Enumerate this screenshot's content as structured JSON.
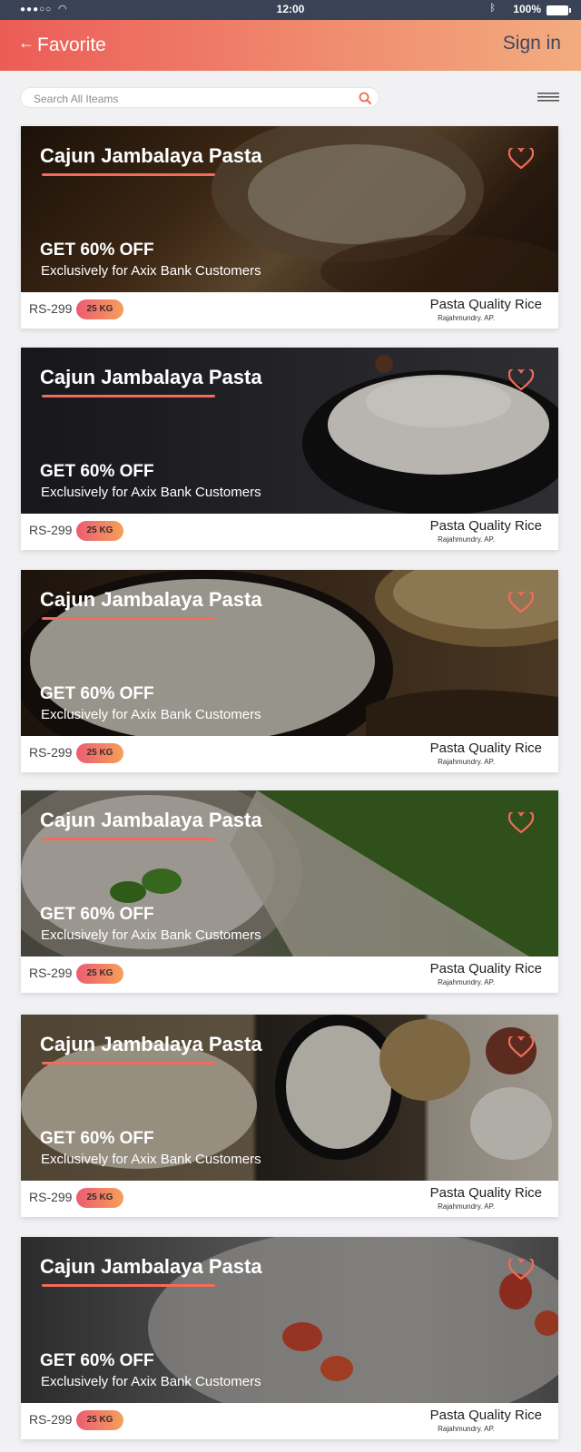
{
  "status_bar": {
    "time": "12:00",
    "battery": "100%"
  },
  "header": {
    "title": "Favorite",
    "sign_in": "Sign in"
  },
  "search": {
    "placeholder": "Search All Iteams"
  },
  "cards": [
    {
      "title": "Cajun Jambalaya Pasta",
      "offer": "GET 60% OFF",
      "offer_sub": "Exclusively for Axix Bank Customers",
      "price": "RS-299",
      "weight": "25 KG",
      "product": "Pasta Quality Rice",
      "location": "Rajahmundry. AP.",
      "image": "rice-sack-on-wood"
    },
    {
      "title": "Cajun Jambalaya Pasta",
      "offer": "GET 60% OFF",
      "offer_sub": "Exclusively for Axix Bank Customers",
      "price": "RS-299",
      "weight": "25 KG",
      "product": "Pasta Quality Rice",
      "location": "Rajahmundry. AP.",
      "image": "rice-in-black-bowl"
    },
    {
      "title": "Cajun Jambalaya Pasta",
      "offer": "GET 60% OFF",
      "offer_sub": "Exclusively for Axix Bank Customers",
      "price": "RS-299",
      "weight": "25 KG",
      "product": "Pasta Quality Rice",
      "location": "Rajahmundry. AP.",
      "image": "rice-bowls-with-grain"
    },
    {
      "title": "Cajun Jambalaya Pasta",
      "offer": "GET 60% OFF",
      "offer_sub": "Exclusively for Axix Bank Customers",
      "price": "RS-299",
      "weight": "25 KG",
      "product": "Pasta Quality Rice",
      "location": "Rajahmundry. AP.",
      "image": "rice-with-leaves-and-field"
    },
    {
      "title": "Cajun Jambalaya Pasta",
      "offer": "GET 60% OFF",
      "offer_sub": "Exclusively for Axix Bank Customers",
      "price": "RS-299",
      "weight": "25 KG",
      "product": "Pasta Quality Rice",
      "location": "Rajahmundry. AP.",
      "image": "rice-varieties-collage"
    },
    {
      "title": "Cajun Jambalaya Pasta",
      "offer": "GET 60% OFF",
      "offer_sub": "Exclusively for Axix Bank Customers",
      "price": "RS-299",
      "weight": "25 KG",
      "product": "Pasta Quality Rice",
      "location": "Rajahmundry. AP.",
      "image": "cooked-rice-closeup"
    }
  ],
  "colors": {
    "accent": "#f26c58",
    "header_start": "#ec5c57",
    "header_end": "#f2ac7e",
    "status_bar": "#3a4256"
  }
}
